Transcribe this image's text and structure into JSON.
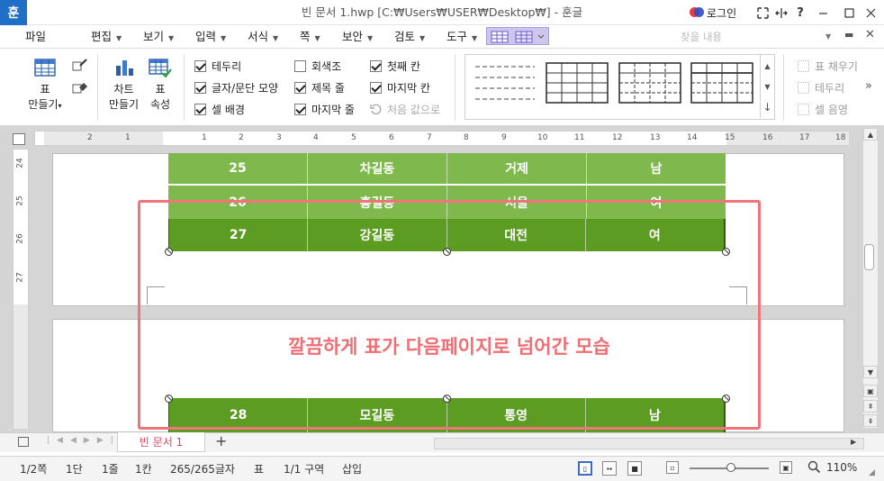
{
  "titlebar": {
    "app_icon": "훈",
    "title": "빈 문서 1.hwp [C:₩Users₩USER₩Desktop₩] - 훈글",
    "login_label": "로그인",
    "icons": [
      "fullscreen-icon",
      "ribbon-toggle-icon",
      "help-icon",
      "minimize-icon",
      "maximize-icon",
      "close-icon"
    ],
    "help_label": "?"
  },
  "menubar": {
    "items": [
      {
        "label": "파일"
      },
      {
        "label": "편집",
        "arrow": "▼"
      },
      {
        "label": "보기",
        "arrow": "▼"
      },
      {
        "label": "입력",
        "arrow": "▼"
      },
      {
        "label": "서식",
        "arrow": "▼"
      },
      {
        "label": "쪽",
        "arrow": "▼"
      },
      {
        "label": "보안",
        "arrow": "▼"
      },
      {
        "label": "검토",
        "arrow": "▼"
      },
      {
        "label": "도구",
        "arrow": "▼"
      }
    ],
    "search_placeholder": "찾을 내용"
  },
  "ribbon": {
    "table_make": {
      "line1": "표",
      "line2": "만들기"
    },
    "chart_make": {
      "line1": "차트",
      "line2": "만들기"
    },
    "table_props": {
      "line1": "표",
      "line2": "속성"
    },
    "options": [
      {
        "label": "테두리",
        "checked": true
      },
      {
        "label": "글자/문단 모양",
        "checked": true
      },
      {
        "label": "셀 배경",
        "checked": true
      },
      {
        "label": "회색조",
        "checked": false
      },
      {
        "label": "제목 줄",
        "checked": true
      },
      {
        "label": "마지막 줄",
        "checked": true
      },
      {
        "label": "첫째 칸",
        "checked": true
      },
      {
        "label": "마지막 칸",
        "checked": true
      }
    ],
    "reset_label": "처음 값으로",
    "right_tools": [
      {
        "label": "표 채우기"
      },
      {
        "label": "테두리"
      },
      {
        "label": "셀 음영"
      }
    ],
    "more": "»"
  },
  "ruler": {
    "h_marks": [
      "2",
      "1",
      "",
      "1",
      "2",
      "3",
      "4",
      "5",
      "6",
      "7",
      "8",
      "9",
      "10",
      "11",
      "12",
      "13",
      "14",
      "15",
      "16",
      "17",
      "18"
    ],
    "v_marks": [
      "24",
      "25",
      "26",
      "27"
    ]
  },
  "table": {
    "rows": [
      {
        "no": "25",
        "name": "차길동",
        "city": "거제",
        "gender": "남"
      },
      {
        "no": "26",
        "name": "홍길동",
        "city": "서울",
        "gender": "여"
      },
      {
        "no": "27",
        "name": "강길동",
        "city": "대전",
        "gender": "여"
      },
      {
        "no": "28",
        "name": "모길동",
        "city": "통영",
        "gender": "남"
      }
    ],
    "colors": {
      "light": "#7fb84c",
      "dark": "#5c9c22"
    }
  },
  "annotation": {
    "caption": "깔끔하게 표가 다음페이지로 넘어간 모습",
    "color": "#f0757b"
  },
  "tabs": {
    "doc_tab": "빈 문서 1",
    "add": "+"
  },
  "status": {
    "page": "1/2쪽",
    "section": "1단",
    "line": "1줄",
    "column": "1칸",
    "chars": "265/265글자",
    "mode": "표",
    "area": "1/1 구역",
    "insert": "삽입",
    "zoom": "110%"
  }
}
